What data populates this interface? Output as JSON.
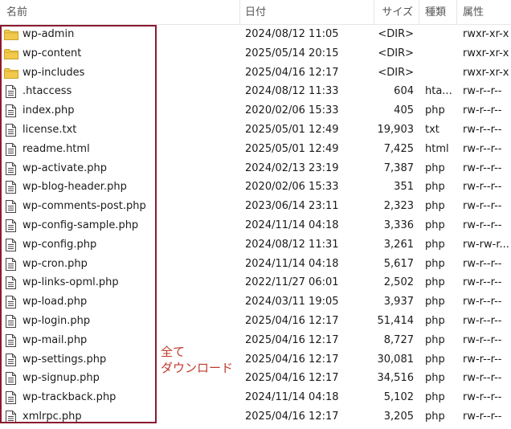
{
  "header": {
    "name": "名前",
    "date": "日付",
    "size": "サイズ",
    "type": "種類",
    "attr": "属性"
  },
  "files": [
    {
      "icon": "folder-icon",
      "name": "wp-admin",
      "date": "2024/08/12 11:05",
      "size": "<DIR>",
      "type": "",
      "attr": "rwxr-xr-x"
    },
    {
      "icon": "folder-icon",
      "name": "wp-content",
      "date": "2025/05/14 20:15",
      "size": "<DIR>",
      "type": "",
      "attr": "rwxr-xr-x"
    },
    {
      "icon": "folder-icon",
      "name": "wp-includes",
      "date": "2025/04/16 12:17",
      "size": "<DIR>",
      "type": "",
      "attr": "rwxr-xr-x"
    },
    {
      "icon": "file-icon",
      "name": ".htaccess",
      "date": "2024/08/12 11:33",
      "size": "604",
      "type": "hta...",
      "attr": "rw-r--r--"
    },
    {
      "icon": "file-icon",
      "name": "index.php",
      "date": "2020/02/06 15:33",
      "size": "405",
      "type": "php",
      "attr": "rw-r--r--"
    },
    {
      "icon": "file-icon",
      "name": "license.txt",
      "date": "2025/05/01 12:49",
      "size": "19,903",
      "type": "txt",
      "attr": "rw-r--r--"
    },
    {
      "icon": "file-icon",
      "name": "readme.html",
      "date": "2025/05/01 12:49",
      "size": "7,425",
      "type": "html",
      "attr": "rw-r--r--"
    },
    {
      "icon": "file-icon",
      "name": "wp-activate.php",
      "date": "2024/02/13 23:19",
      "size": "7,387",
      "type": "php",
      "attr": "rw-r--r--"
    },
    {
      "icon": "file-icon",
      "name": "wp-blog-header.php",
      "date": "2020/02/06 15:33",
      "size": "351",
      "type": "php",
      "attr": "rw-r--r--"
    },
    {
      "icon": "file-icon",
      "name": "wp-comments-post.php",
      "date": "2023/06/14 23:11",
      "size": "2,323",
      "type": "php",
      "attr": "rw-r--r--"
    },
    {
      "icon": "file-icon",
      "name": "wp-config-sample.php",
      "date": "2024/11/14 04:18",
      "size": "3,336",
      "type": "php",
      "attr": "rw-r--r--"
    },
    {
      "icon": "file-icon",
      "name": "wp-config.php",
      "date": "2024/08/12 11:31",
      "size": "3,261",
      "type": "php",
      "attr": "rw-rw-r..."
    },
    {
      "icon": "file-icon",
      "name": "wp-cron.php",
      "date": "2024/11/14 04:18",
      "size": "5,617",
      "type": "php",
      "attr": "rw-r--r--"
    },
    {
      "icon": "file-icon",
      "name": "wp-links-opml.php",
      "date": "2022/11/27 06:01",
      "size": "2,502",
      "type": "php",
      "attr": "rw-r--r--"
    },
    {
      "icon": "file-icon",
      "name": "wp-load.php",
      "date": "2024/03/11 19:05",
      "size": "3,937",
      "type": "php",
      "attr": "rw-r--r--"
    },
    {
      "icon": "file-icon",
      "name": "wp-login.php",
      "date": "2025/04/16 12:17",
      "size": "51,414",
      "type": "php",
      "attr": "rw-r--r--"
    },
    {
      "icon": "file-icon",
      "name": "wp-mail.php",
      "date": "2025/04/16 12:17",
      "size": "8,727",
      "type": "php",
      "attr": "rw-r--r--"
    },
    {
      "icon": "file-icon",
      "name": "wp-settings.php",
      "date": "2025/04/16 12:17",
      "size": "30,081",
      "type": "php",
      "attr": "rw-r--r--"
    },
    {
      "icon": "file-icon",
      "name": "wp-signup.php",
      "date": "2025/04/16 12:17",
      "size": "34,516",
      "type": "php",
      "attr": "rw-r--r--"
    },
    {
      "icon": "file-icon",
      "name": "wp-trackback.php",
      "date": "2024/11/14 04:18",
      "size": "5,102",
      "type": "php",
      "attr": "rw-r--r--"
    },
    {
      "icon": "file-icon",
      "name": "xmlrpc.php",
      "date": "2025/04/16 12:17",
      "size": "3,205",
      "type": "php",
      "attr": "rw-r--r--"
    }
  ],
  "annotation": {
    "line1": "全て",
    "line2": "ダウンロード",
    "color": "#c0392b",
    "box_color": "#8b1a2e"
  },
  "colors": {
    "folder": "#f2c94c",
    "folder_edge": "#c9a227",
    "file_edge": "#444444"
  }
}
